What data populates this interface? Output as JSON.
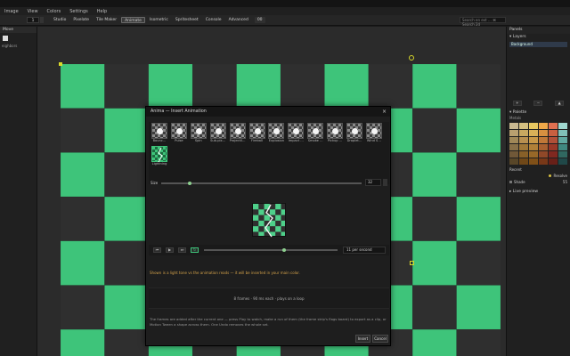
{
  "menu": [
    "Image",
    "View",
    "Colors",
    "Settings",
    "Help"
  ],
  "toolbar": {
    "brush_size": "1",
    "tabs": [
      {
        "label": "Studio",
        "active": false
      },
      {
        "label": "Pixelate",
        "active": false
      },
      {
        "label": "Tile Maker",
        "active": false
      },
      {
        "label": "Animate",
        "active": true
      },
      {
        "label": "Isometric",
        "active": false
      },
      {
        "label": "Spritesheet",
        "active": false
      },
      {
        "label": "Console",
        "active": false
      },
      {
        "label": "Advanced",
        "active": false
      }
    ],
    "extra": "00",
    "search_placeholder": "Search en ext … ⌘ Search 2d"
  },
  "left_panel": {
    "header": "Move",
    "sub": "eighbors"
  },
  "right_panel": {
    "title": "Panels",
    "layers_header": "Layers",
    "layer_name": "Background",
    "layer_btns": [
      "+",
      "−",
      "▲"
    ],
    "palette_header": "Palette",
    "palette_name": "Metals",
    "swatch_colors": [
      "#c8b890",
      "#d4c080",
      "#e8c860",
      "#f0a848",
      "#e07050",
      "#a0d8d0",
      "#b8a070",
      "#c8a860",
      "#d8b058",
      "#d89040",
      "#c86040",
      "#80c0b8",
      "#a08858",
      "#b89050",
      "#c89848",
      "#c07838",
      "#b05038",
      "#60a8a0",
      "#887048",
      "#a07838",
      "#b08038",
      "#a86030",
      "#983828",
      "#408880",
      "#705838",
      "#886028",
      "#986828",
      "#904828",
      "#802820",
      "#306860",
      "#584628",
      "#704818",
      "#805018",
      "#783818",
      "#682018",
      "#204848"
    ],
    "recent_label": "Recent",
    "shade_label": "Shade",
    "shade_value": "55",
    "resolve_label": "Resolve",
    "live_preview": "Live preview"
  },
  "dialog": {
    "title": "Anima — Insert Animation",
    "presets": [
      {
        "label": "Bounc…",
        "selected": false
      },
      {
        "label": "Pulse",
        "selected": false
      },
      {
        "label": "Spin",
        "selected": false
      },
      {
        "label": "Sub-pix…",
        "selected": false
      },
      {
        "label": "Projectil…",
        "selected": false
      },
      {
        "label": "Fireball",
        "selected": false
      },
      {
        "label": "Explosion",
        "selected": false
      },
      {
        "label": "Impact …",
        "selected": false
      },
      {
        "label": "Smoke …",
        "selected": false
      },
      {
        "label": "Pickup …",
        "selected": false
      },
      {
        "label": "Droplet…",
        "selected": false
      },
      {
        "label": "Wind S…",
        "selected": false
      },
      {
        "label": "Lightning",
        "selected": true
      }
    ],
    "size_label": "Size",
    "size_value": "32",
    "size_level": 0.14,
    "play_buttons": [
      "⏮",
      "▶",
      "⏭",
      "↻"
    ],
    "fps_value": "11 per second",
    "hint": "Shown is a light tone vs the animation reads — it will be inserted in your main color.",
    "info": "8 frames · 90 ms each · plays on a loop",
    "footer": "The frames are added after the current one — press Play to watch, make a run of them (the frame strip's flags board) to export as a clip, or Motion Tween a shape across them. One Undo removes the whole set.",
    "insert_label": "Insert",
    "cancel_label": "Cancel"
  },
  "colors": {
    "green": "#3ec47a",
    "dark": "#2f2f2f",
    "accent_warn": "#d4a24a"
  }
}
